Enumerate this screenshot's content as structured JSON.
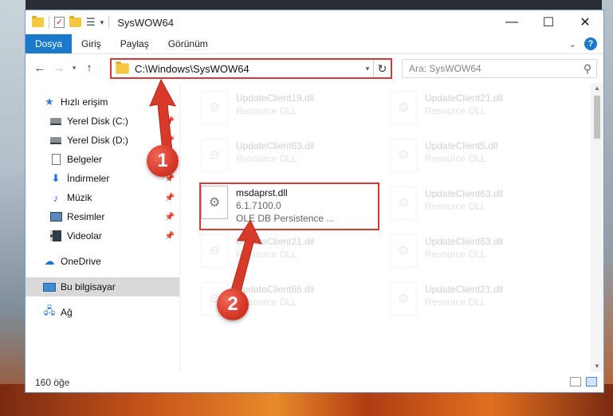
{
  "window": {
    "title": "SysWOW64",
    "controls": {
      "minimize": "—",
      "maximize": "☐",
      "close": "✕"
    }
  },
  "ribbon": {
    "tabs": [
      {
        "label": "Dosya",
        "active": true
      },
      {
        "label": "Giriş"
      },
      {
        "label": "Paylaş"
      },
      {
        "label": "Görünüm"
      }
    ],
    "help_label": "?"
  },
  "navigation": {
    "address": "C:\\Windows\\SysWOW64",
    "search_placeholder": "Ara: SysWOW64"
  },
  "sidebar": {
    "items": [
      {
        "label": "Hızlı erişim",
        "icon": "star-icon"
      },
      {
        "label": "Yerel Disk (C:)",
        "icon": "drive-icon",
        "pinned": true
      },
      {
        "label": "Yerel Disk (D:)",
        "icon": "drive-icon",
        "pinned": true
      },
      {
        "label": "Belgeler",
        "icon": "documents-icon",
        "pinned": true
      },
      {
        "label": "İndirmeler",
        "icon": "downloads-icon",
        "pinned": true
      },
      {
        "label": "Müzik",
        "icon": "music-icon",
        "pinned": true
      },
      {
        "label": "Resimler",
        "icon": "pictures-icon",
        "pinned": true
      },
      {
        "label": "Videolar",
        "icon": "videos-icon",
        "pinned": true
      },
      {
        "label": "OneDrive",
        "icon": "onedrive-icon"
      },
      {
        "label": "Bu bilgisayar",
        "icon": "this-pc-icon",
        "selected": true
      },
      {
        "label": "Ağ",
        "icon": "network-icon"
      }
    ]
  },
  "files": {
    "items": [
      {
        "name": "UpdateClient19.dll",
        "detail": "Resource DLL"
      },
      {
        "name": "UpdateClient21.dll",
        "detail": "Resource DLL"
      },
      {
        "name": "UpdateClient63.dll",
        "detail": "Resource DLL"
      },
      {
        "name": "UpdateClient5.dll",
        "detail": "Resource DLL"
      },
      {
        "name": "msdaprst.dll",
        "version": "6.1.7100.0",
        "detail": "OLE DB Persistence ...",
        "highlighted": true
      },
      {
        "name": "UpdateClient63.dll",
        "detail": "Resource DLL"
      },
      {
        "name": "UpdateClient21.dll",
        "detail": "Resource DLL"
      },
      {
        "name": "UpdateClient63.dll",
        "detail": "Resource DLL"
      },
      {
        "name": "UpdateClient65.dll",
        "detail": "Resource DLL"
      },
      {
        "name": "UpdateClient21.dll",
        "detail": "Resource DLL"
      }
    ]
  },
  "status": {
    "count": "160 öğe"
  },
  "callouts": {
    "step1": "1",
    "step2": "2"
  },
  "colors": {
    "accent": "#1979ca",
    "highlight": "#d33a3a"
  }
}
